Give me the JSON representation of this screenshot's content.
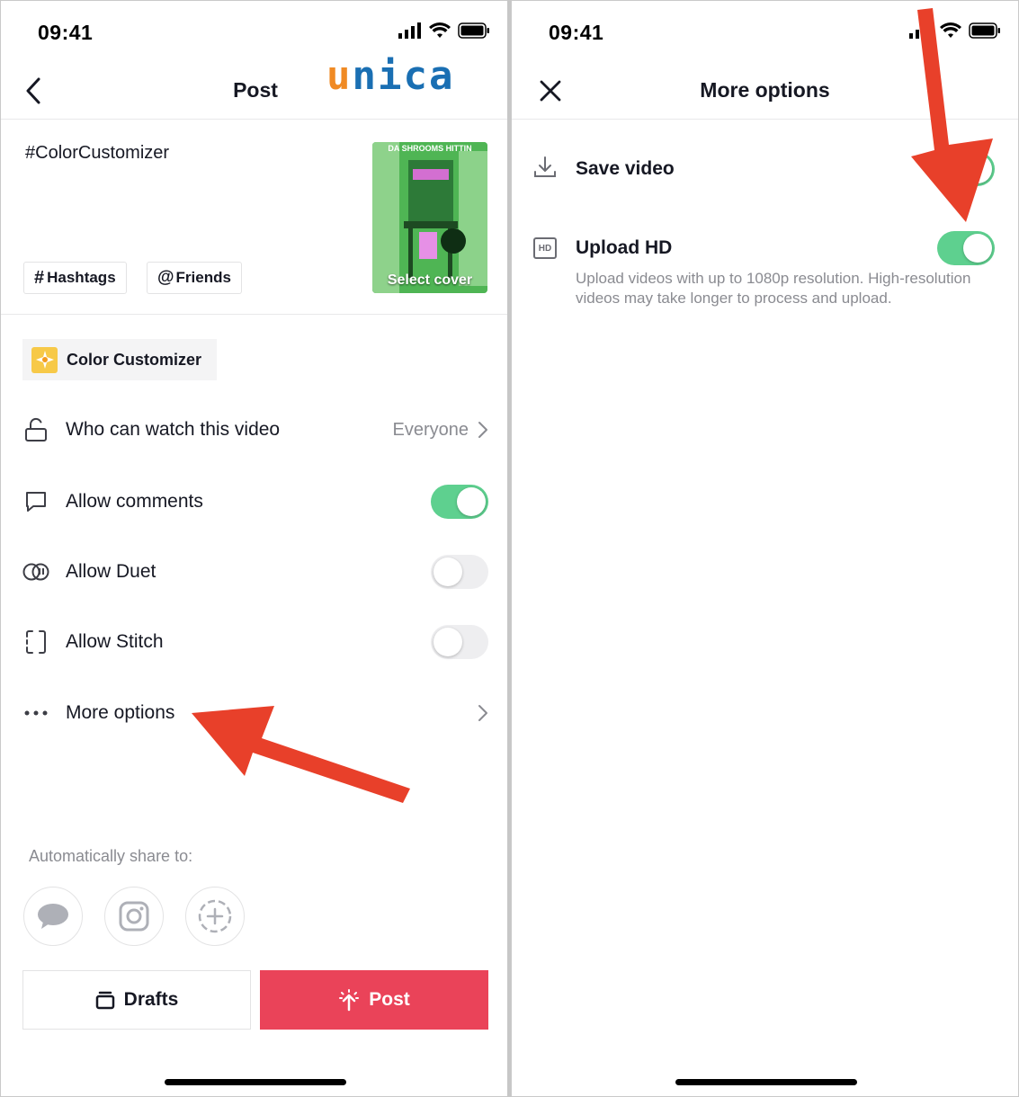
{
  "status_bar": {
    "time": "09:41"
  },
  "logo": {
    "text": "unica",
    "colors": [
      "#f08a24",
      "#1a6fb3"
    ]
  },
  "post_screen": {
    "title": "Post",
    "caption": "#ColorCustomizer",
    "hashtags_label": "Hashtags",
    "friends_label": "Friends",
    "thumbnail": {
      "top_text": "DA SHROOMS HITTIN",
      "cover_label": "Select cover"
    },
    "effect": {
      "label": "Color Customizer"
    },
    "rows": {
      "who_can_watch": {
        "label": "Who can watch this video",
        "value": "Everyone"
      },
      "allow_comments": {
        "label": "Allow comments",
        "enabled": true
      },
      "allow_duet": {
        "label": "Allow Duet",
        "enabled": false
      },
      "allow_stitch": {
        "label": "Allow Stitch",
        "enabled": false
      },
      "more_options": {
        "label": "More options"
      }
    },
    "share": {
      "label": "Automatically share to:",
      "targets": [
        "message-icon",
        "instagram-icon",
        "add-circle-icon"
      ]
    },
    "drafts_label": "Drafts",
    "post_label": "Post",
    "colors": {
      "post_button": "#ea4359",
      "toggle_on": "#5ed08f"
    }
  },
  "options_screen": {
    "title": "More options",
    "save_video": {
      "label": "Save video",
      "enabled": true
    },
    "upload_hd": {
      "label": "Upload HD",
      "enabled": true,
      "icon_text": "HD",
      "description": "Upload videos with up to 1080p resolution. High-resolution videos may take longer to process and upload."
    }
  },
  "annotations": {
    "arrow_color": "#e8402a"
  }
}
